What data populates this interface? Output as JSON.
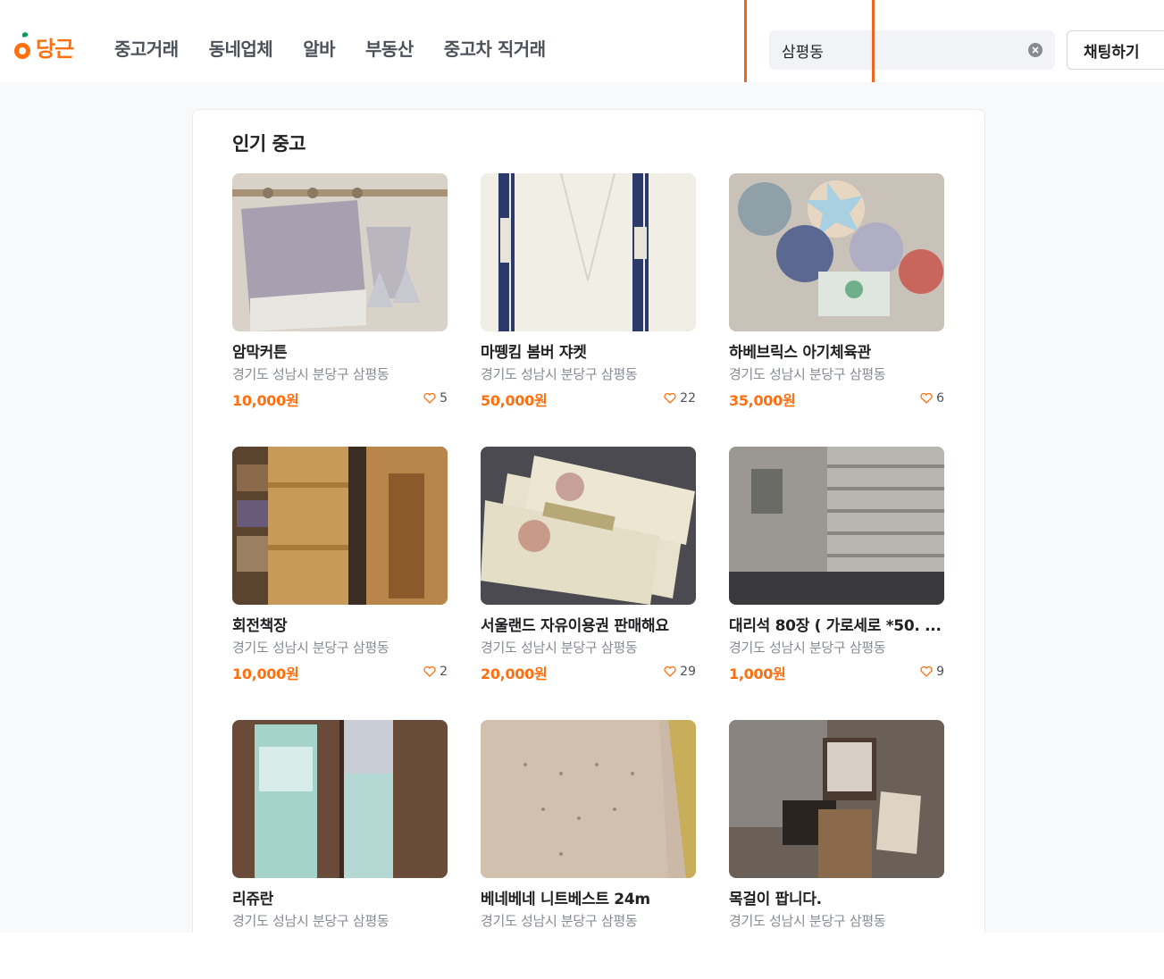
{
  "brand": {
    "name": "당근",
    "color": "#ff6f0f"
  },
  "nav": [
    "중고거래",
    "동네업체",
    "알바",
    "부동산",
    "중고차 직거래"
  ],
  "search": {
    "value": "삼평동",
    "clear_icon": "close-circle-icon"
  },
  "chat_button": "채팅하기",
  "section_title": "인기 중고",
  "colors": {
    "price": "#ff6f0f",
    "highlight": "#ec6622",
    "muted": "#868b94"
  },
  "items": [
    {
      "title": "암막커튼",
      "region": "경기도 성남시 분당구 삼평동",
      "price": "10,000원",
      "likes": "5",
      "image": "curtain-photo"
    },
    {
      "title": "마뗑킴 봄버 쟈켓",
      "region": "경기도 성남시 분당구 삼평동",
      "price": "50,000원",
      "likes": "22",
      "image": "jacket-photo"
    },
    {
      "title": "하베브릭스 아기체육관",
      "region": "경기도 성남시 분당구 삼평동",
      "price": "35,000원",
      "likes": "6",
      "image": "baby-gym-photo"
    },
    {
      "title": "회전책장",
      "region": "경기도 성남시 분당구 삼평동",
      "price": "10,000원",
      "likes": "2",
      "image": "bookshelf-photo"
    },
    {
      "title": "서울랜드 자유이용권 판매해요",
      "region": "경기도 성남시 분당구 삼평동",
      "price": "20,000원",
      "likes": "29",
      "image": "tickets-photo"
    },
    {
      "title": "대리석 80장 ( 가로세로 *50. ...",
      "region": "경기도 성남시 분당구 삼평동",
      "price": "1,000원",
      "likes": "9",
      "image": "marble-photo"
    },
    {
      "title": "리쥬란",
      "region": "경기도 성남시 분당구 삼평동",
      "image": "toner-photo"
    },
    {
      "title": "베네베네 니트베스트 24m",
      "region": "경기도 성남시 분당구 삼평동",
      "image": "knit-vest-photo"
    },
    {
      "title": "목걸이 팝니다.",
      "region": "경기도 성남시 분당구 삼평동",
      "image": "necklace-photo"
    }
  ]
}
